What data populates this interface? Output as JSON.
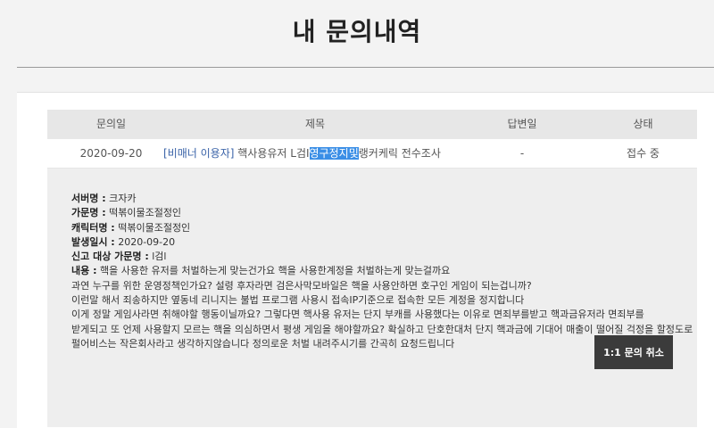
{
  "page": {
    "title": "내 문의내역"
  },
  "table": {
    "headers": [
      "문의일",
      "제목",
      "답변일",
      "상태"
    ],
    "row": {
      "date": "2020-09-20",
      "category": "[비매너 이용자]",
      "subject_before": "핵사용유저 L검I",
      "subject_highlight": "영구정지및",
      "subject_after": "랭커케릭 전수조사",
      "answer_date": "-",
      "status": "접수 중"
    }
  },
  "detail": {
    "fields": [
      {
        "label": "서버명 :",
        "value": "크자카"
      },
      {
        "label": "가문명 :",
        "value": "떡볶이물조절정인"
      },
      {
        "label": "캐릭터명 :",
        "value": "떡볶이물조절정인"
      },
      {
        "label": "발생일시 :",
        "value": "2020-09-20"
      },
      {
        "label": "신고 대상 가문명 :",
        "value": "l검l"
      }
    ],
    "content_label": "내용 :",
    "content_lines": [
      "핵을 사용한 유저를 처벌하는게 맞는건가요 핵을 사용한계정을 처벌하는게 맞는걸까요",
      "과연 누구를 위한 운영정책인가요? 설령 후자라면 검은사막모바일은 핵을 사용안하면 호구인 게임이 되는겁니까?",
      "이런말 해서 죄송하지만 옆동네 리니지는 불법 프로그램 사용시 접속IP기준으로 접속한 모든 계정을 정지합니다",
      "이게 정말 게임사라면 취해야할 행동이닐까요? 그렇다면 핵사용 유저는 단지 부캐를 사용했다는 이유로 면죄부를받고 핵과금유저라 면죄부를",
      "받게되고 또 언제 사용할지 모르는 핵을 의심하면서 평생 게임을 해야할까요? 확실하고 단호한대처 단지 핵과금에 기대어 매출이 떨어질 걱정을 할정도로",
      "펄어비스는 작은회사라고 생각하지않습니다 정의로운 처벌 내려주시기를 간곡히 요청드립니다"
    ],
    "cancel_label": "1:1 문의 취소"
  }
}
